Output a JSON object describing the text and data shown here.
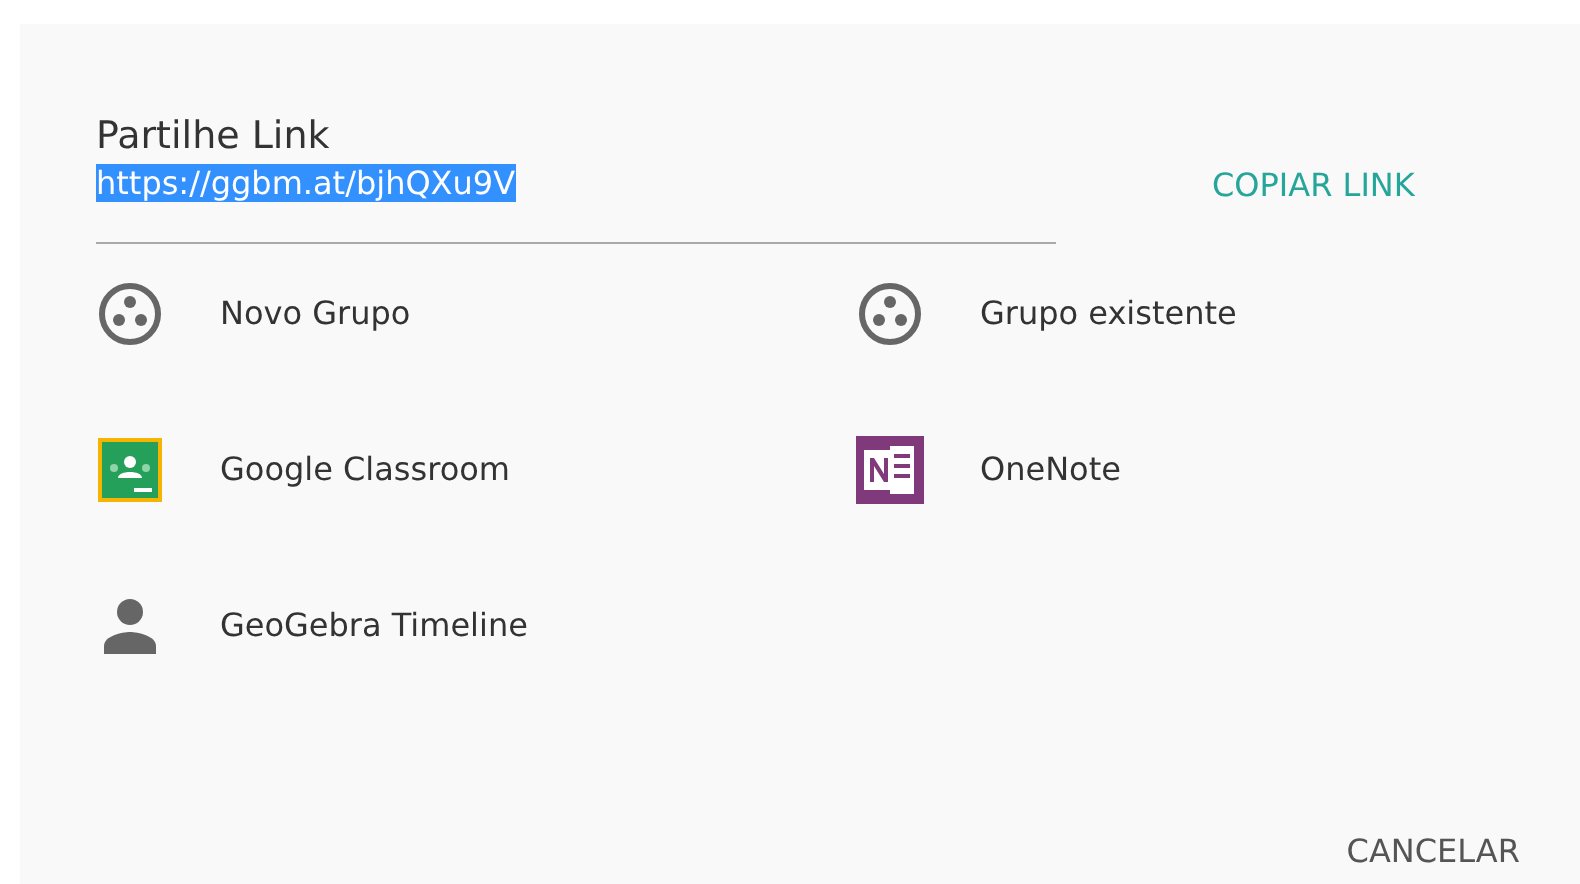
{
  "dialog": {
    "title": "Partilhe Link",
    "link": {
      "value": "https://ggbm.at/bjhQXu9V",
      "text_selected": true
    },
    "copy_button": "COPIAR LINK",
    "options": [
      {
        "kind": "group",
        "label": "Novo Grupo"
      },
      {
        "kind": "group",
        "label": "Grupo existente"
      },
      {
        "kind": "classroom",
        "label": "Google Classroom"
      },
      {
        "kind": "onenote",
        "label": "OneNote"
      },
      {
        "kind": "person",
        "label": "GeoGebra Timeline"
      }
    ],
    "cancel_button": "CANCELAR"
  }
}
